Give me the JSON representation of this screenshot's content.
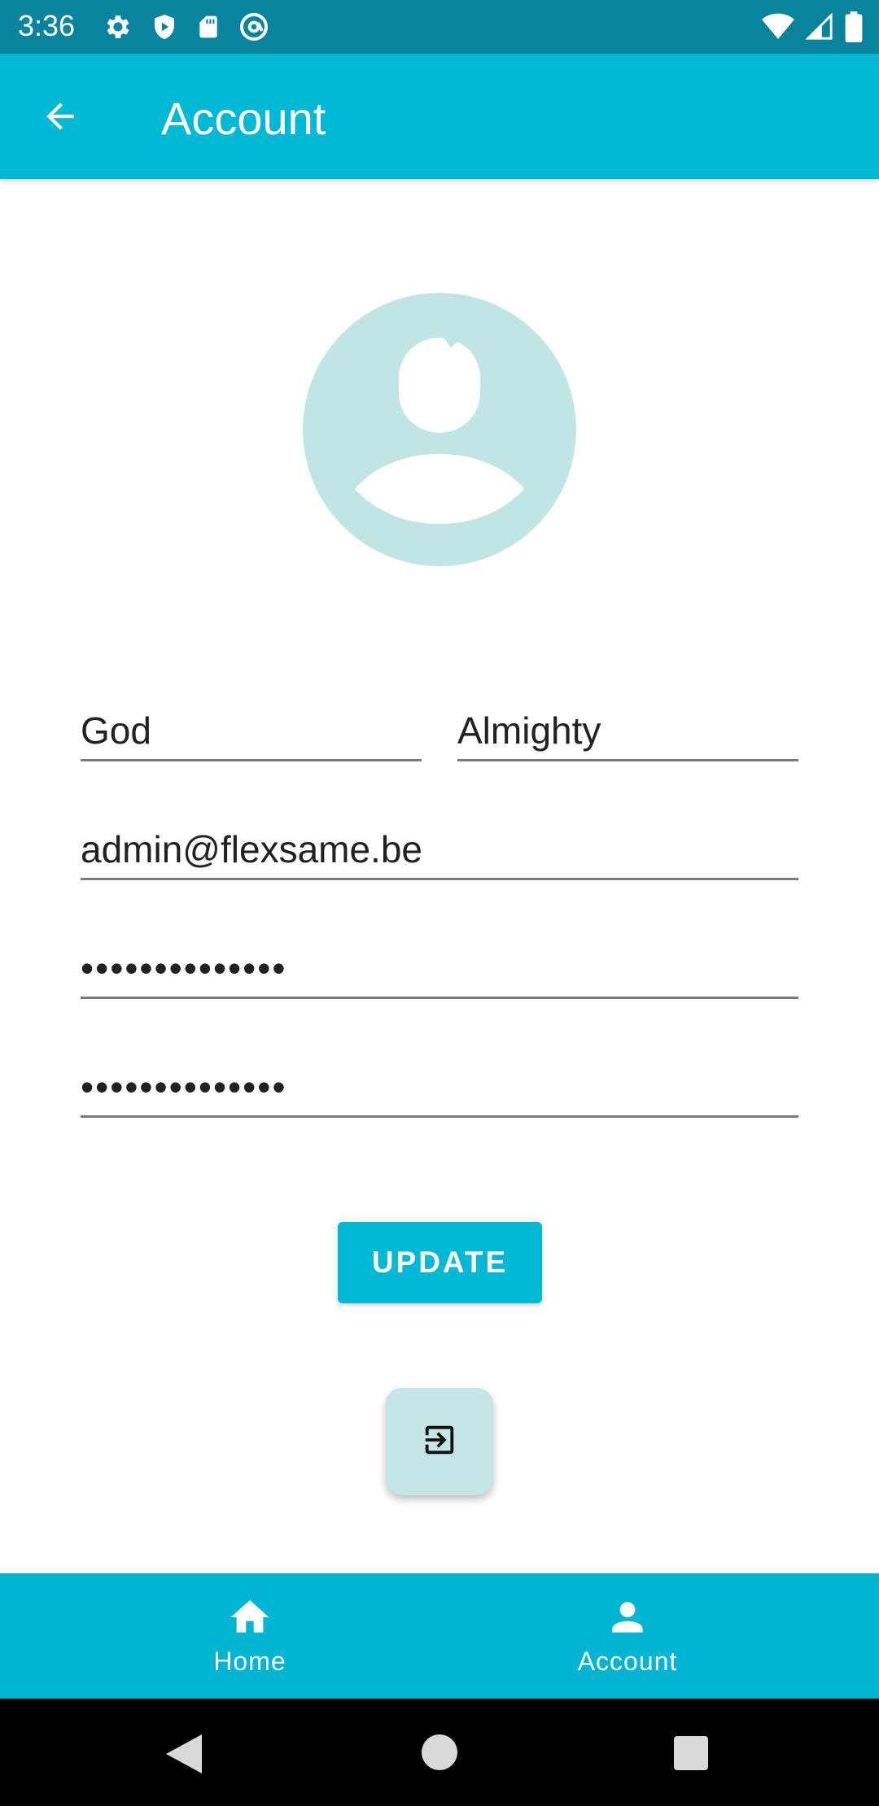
{
  "status_bar": {
    "time": "3:36",
    "left_icons": [
      "settings-icon",
      "shield-play-icon",
      "sd-card-icon",
      "at-sign-icon"
    ],
    "right_icons": [
      "wifi-icon",
      "signal-icon",
      "battery-icon"
    ]
  },
  "app_bar": {
    "title": "Account",
    "back_icon": "arrow-back-icon"
  },
  "profile": {
    "avatar_icon": "account-circle-icon"
  },
  "form": {
    "first_name": "God",
    "last_name": "Almighty",
    "email": "admin@flexsame.be",
    "password": "••••••••••••••",
    "password_confirm": "••••••••••••••",
    "update_label": "UPDATE",
    "logout_icon": "exit-to-app-icon"
  },
  "bottom_nav": {
    "items": [
      {
        "label": "Home",
        "icon": "home-icon"
      },
      {
        "label": "Account",
        "icon": "person-icon"
      }
    ]
  },
  "colors": {
    "status_bar": "#0a839f",
    "primary": "#00b8d4",
    "avatar": "#c1e4e5",
    "fab": "#c5e5e7"
  }
}
